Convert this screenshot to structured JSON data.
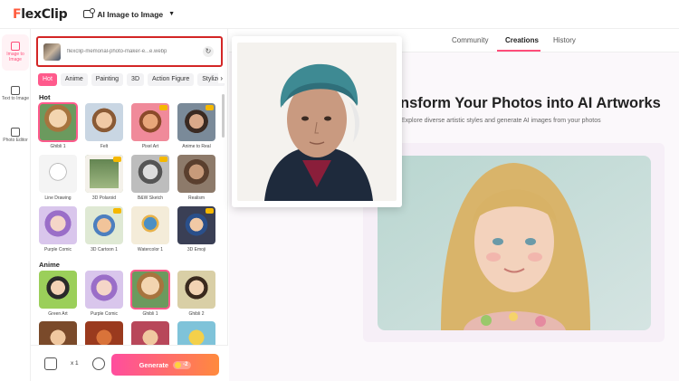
{
  "app": {
    "logo_text": "FlexClip",
    "tool_name": "AI Image to Image"
  },
  "rail": {
    "items": [
      {
        "label": "Image to Image",
        "icon": "image-to-image-icon",
        "active": true
      },
      {
        "label": "Text to Image",
        "icon": "text-to-image-icon",
        "active": false
      },
      {
        "label": "Photo Editor",
        "icon": "photo-editor-icon",
        "active": false
      }
    ]
  },
  "upload": {
    "filename": "flexclip-memorial-photo-maker-e...e.webp"
  },
  "style_tabs": [
    "Hot",
    "Anime",
    "Painting",
    "3D",
    "Action Figure",
    "Stylize"
  ],
  "sections": {
    "hot": {
      "title": "Hot",
      "items": [
        {
          "label": "Ghibli 1",
          "selected": true,
          "premium": false
        },
        {
          "label": "Felt",
          "selected": false,
          "premium": false
        },
        {
          "label": "Pixel Art",
          "selected": false,
          "premium": true
        },
        {
          "label": "Anime to Real",
          "selected": false,
          "premium": true
        },
        {
          "label": "Line Drawing",
          "selected": false,
          "premium": false
        },
        {
          "label": "3D Polaroid",
          "selected": false,
          "premium": true
        },
        {
          "label": "B&W Sketch",
          "selected": false,
          "premium": true
        },
        {
          "label": "Realism",
          "selected": false,
          "premium": false
        },
        {
          "label": "Purple Comic",
          "selected": false,
          "premium": false
        },
        {
          "label": "3D Cartoon 1",
          "selected": false,
          "premium": true
        },
        {
          "label": "Watercolor 1",
          "selected": false,
          "premium": false
        },
        {
          "label": "3D Emoji",
          "selected": false,
          "premium": true
        }
      ]
    },
    "anime": {
      "title": "Anime",
      "items": [
        {
          "label": "Green Art",
          "selected": false,
          "premium": false
        },
        {
          "label": "Purple Comic",
          "selected": false,
          "premium": false
        },
        {
          "label": "Ghibli 1",
          "selected": true,
          "premium": false
        },
        {
          "label": "Ghibli 2",
          "selected": false,
          "premium": false
        }
      ]
    }
  },
  "bottom": {
    "count": "x 1",
    "generate_label": "Generate",
    "credit": "-2"
  },
  "main": {
    "tabs": [
      "Community",
      "Creations",
      "History"
    ],
    "active_tab": "Creations",
    "hero_title": "nsform Your Photos into AI Artworks",
    "hero_subtitle": "Explore diverse artistic styles and generate AI images from your photos"
  },
  "colors": {
    "accent": "#ff4d7a",
    "highlight_border": "#d32626",
    "logo_orange": "#ff5a3c"
  }
}
